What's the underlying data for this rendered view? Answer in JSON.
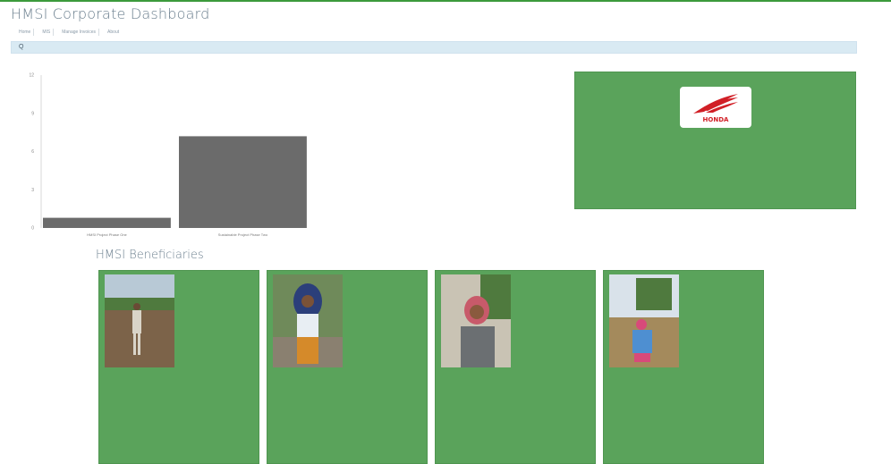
{
  "app": {
    "title": "HMSI Corporate Dashboard"
  },
  "menu": [
    {
      "label": "Home"
    },
    {
      "label": "MIS"
    },
    {
      "label": "Manage Invoices"
    },
    {
      "label": "About"
    }
  ],
  "filter": {
    "value": "Q"
  },
  "section": {
    "beneficiaries_title": "HMSI Beneficiaries"
  },
  "colors": {
    "card_green": "#5aa35b",
    "bar_grey": "#6b6b6b",
    "accent_red": "#d11f26"
  },
  "chart_data": {
    "type": "bar",
    "categories": [
      "HMSI Project Phase One",
      "Sustainable Project Phase Two"
    ],
    "values": [
      0.8,
      7.2
    ],
    "ylim": [
      0,
      12
    ],
    "yticks": [
      "0",
      "3",
      "6",
      "9",
      "12"
    ],
    "grid": false
  },
  "company_card": {
    "logo_text": "HONDA",
    "lines": [
      "",
      "",
      "",
      "",
      "",
      ""
    ]
  },
  "beneficiaries": [
    {
      "rows": [
        "",
        "",
        "",
        "",
        "",
        "",
        "",
        "",
        "",
        "",
        "",
        ""
      ]
    },
    {
      "rows": [
        "",
        "",
        "",
        "",
        "",
        "",
        "",
        "",
        "",
        "",
        "",
        ""
      ]
    },
    {
      "rows": [
        "",
        "",
        "",
        "",
        "",
        "",
        "",
        "",
        "",
        "",
        "",
        ""
      ]
    },
    {
      "rows": [
        "",
        "",
        "",
        "",
        "",
        "",
        "",
        "",
        "",
        "",
        "",
        ""
      ]
    }
  ]
}
